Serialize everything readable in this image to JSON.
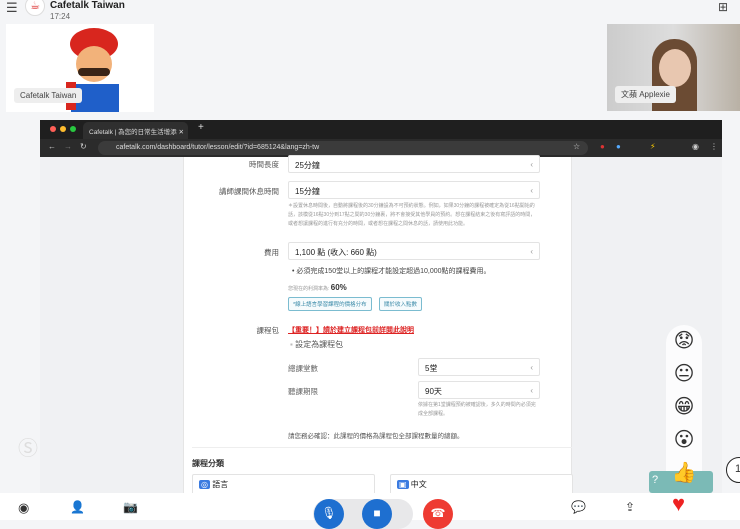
{
  "header": {
    "title": "Cafetalk Taiwan",
    "time": "17:24"
  },
  "participants": [
    {
      "name": "Cafetalk Taiwan"
    },
    {
      "name": "文蘋 Applexie"
    }
  ],
  "browser": {
    "tab_title": "Cafetalk | 為您的日常生活增添",
    "url": "cafetalk.com/dashboard/tutor/lesson/edit/?id=685124&lang=zh-tw"
  },
  "form": {
    "duration_label": "時間長度",
    "duration_value": "25分鐘",
    "break_label": "講師課間休息時間",
    "break_value": "15分鐘",
    "break_note": "＊設置休息時間後，自動將課程後的30分鐘設為不可預約狀態。例如，如果30分鐘的課程被確定為從16點開始的話，該模從16點30分到17點之間的30分鐘裏，將不會接受其他學員的預約。想在課程結束之後有寫評語的時間，或者想讓課程的進行有充分的時間，或者想在課程之間休息的話，請使用此功能。",
    "fee_label": "費用",
    "fee_value": "1,100 點 (收入: 660 點)",
    "fee_note": "必須完成150堂以上的課程才能設定超過10,000點的課程費用。",
    "profit_label": "您現在的利潤率為:",
    "profit_value": "60%",
    "btn_price_dist": "*線上語言學習課程的價格分布",
    "btn_income": "關於收入點數",
    "package_label": "課程包",
    "package_link": "【重要！】請於建立課程包前詳閱此說明",
    "package_checkbox": "設定為課程包",
    "total_label": "總課堂數",
    "total_value": "5堂",
    "period_label": "聽課期限",
    "period_value": "90天",
    "period_note": "依據在第1堂課程預約被確認後，多久的時間內必須完成全部課程。",
    "confirm_text": "請您務必確認：此課程的價格為課程包全部課程數量的總額。",
    "category_title": "課程分類",
    "category1": "語言",
    "category2": "中文"
  },
  "reactions": [
    "worried",
    "neutral",
    "laugh",
    "surprised",
    "thumbs-up",
    "heart"
  ],
  "page_badge": "1"
}
